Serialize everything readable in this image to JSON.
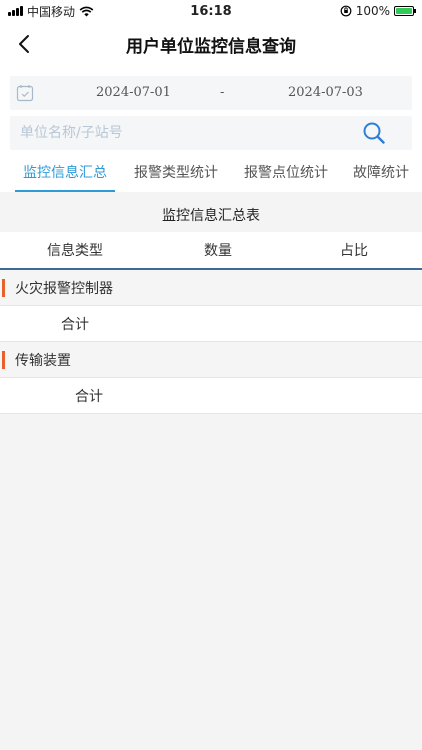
{
  "status_bar": {
    "carrier": "中国移动",
    "time": "16:18",
    "battery": "100%"
  },
  "header": {
    "title": "用户单位监控信息查询",
    "back_icon": "chevron-left-icon"
  },
  "filters": {
    "start_date": "2024-07-01",
    "separator": "-",
    "end_date": "2024-07-03",
    "search_placeholder": "单位名称/子站号",
    "search_value": ""
  },
  "tabs": [
    {
      "label": "监控信息汇总",
      "active": true
    },
    {
      "label": "报警类型统计",
      "active": false
    },
    {
      "label": "报警点位统计",
      "active": false
    },
    {
      "label": "故障统计",
      "active": false
    }
  ],
  "table": {
    "title": "监控信息汇总表",
    "headers": [
      "信息类型",
      "数量",
      "占比"
    ],
    "groups": [
      {
        "name": "火灾报警控制器",
        "total_label": "合计",
        "count": "",
        "ratio": ""
      },
      {
        "name": "传输装置",
        "total_label": "合计",
        "count": "",
        "ratio": ""
      }
    ]
  },
  "colors": {
    "accent": "#2f9bd6",
    "marker": "#e8612c",
    "header_border": "#3b6b96",
    "battery": "#34c759"
  }
}
